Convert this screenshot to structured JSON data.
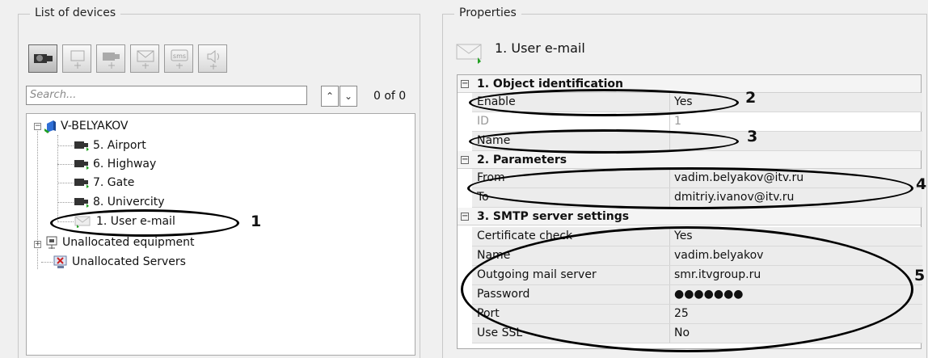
{
  "left_panel": {
    "title": "List of devices",
    "toolbar": {
      "buttons": [
        {
          "name": "search-devices-button",
          "icon": "camera-search-icon"
        },
        {
          "name": "add-detector-button",
          "icon": "add-detector-icon"
        },
        {
          "name": "add-camera-button",
          "icon": "add-camera-icon"
        },
        {
          "name": "add-email-button",
          "icon": "add-email-icon"
        },
        {
          "name": "add-sms-button",
          "icon": "add-sms-icon",
          "label": "sms"
        },
        {
          "name": "add-speaker-button",
          "icon": "add-speaker-icon"
        }
      ]
    },
    "search": {
      "placeholder": "Search..."
    },
    "nav": {
      "up": "^",
      "down": "v"
    },
    "count": "0 of 0",
    "tree": {
      "server": "V-BELYAKOV",
      "cameras": [
        "5. Airport",
        "6. Highway",
        "7. Gate",
        "8. Univercity"
      ],
      "email_item": "1. User e-mail",
      "unallocated_equipment": "Unallocated equipment",
      "unallocated_servers": "Unallocated Servers"
    }
  },
  "right_panel": {
    "title": "Properties",
    "object_title": "1. User e-mail",
    "categories": [
      {
        "label": "1. Object identification",
        "rows": [
          {
            "key": "Enable",
            "value": "Yes"
          },
          {
            "key": "ID",
            "value": "1"
          },
          {
            "key": "Name",
            "value": ""
          }
        ]
      },
      {
        "label": "2. Parameters",
        "rows": [
          {
            "key": "From",
            "value": "vadim.belyakov@itv.ru"
          },
          {
            "key": "To",
            "value": "dmitriy.ivanov@itv.ru"
          }
        ]
      },
      {
        "label": "3. SMTP server settings",
        "rows": [
          {
            "key": "Certificate check",
            "value": "Yes"
          },
          {
            "key": "Name",
            "value": "vadim.belyakov"
          },
          {
            "key": "Outgoing mail server",
            "value": "smr.itvgroup.ru"
          },
          {
            "key": "Password",
            "value": "●●●●●●●"
          },
          {
            "key": "Port",
            "value": "25"
          },
          {
            "key": "Use SSL",
            "value": "No"
          }
        ]
      }
    ]
  },
  "callouts": [
    "1",
    "2",
    "3",
    "4",
    "5"
  ],
  "colors": {
    "highlight": "#ececec",
    "accent_green": "#22a022",
    "server_blue": "#2f6fd6"
  }
}
